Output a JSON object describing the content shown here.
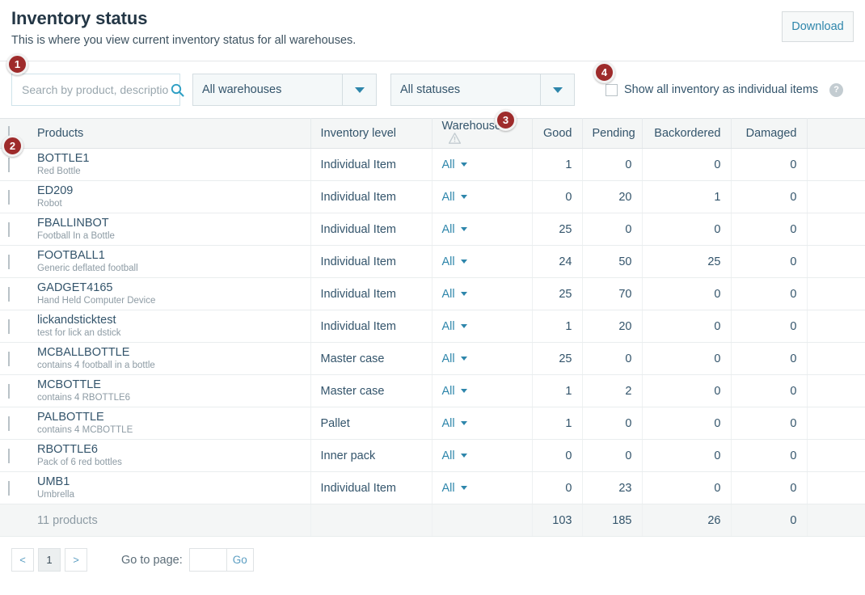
{
  "header": {
    "title": "Inventory status",
    "subtitle": "This is where you view current inventory status for all warehouses.",
    "download_label": "Download"
  },
  "toolbar": {
    "search_placeholder": "Search by product, description",
    "search_value": "",
    "search_icon": "search-icon",
    "warehouse_filter": "All warehouses",
    "status_filter": "All statuses",
    "show_individual_label": "Show all inventory as individual items",
    "show_individual_checked": false,
    "help_icon": "?"
  },
  "table": {
    "columns": {
      "products": "Products",
      "inventory_level": "Inventory level",
      "warehouse": "Warehouse",
      "good": "Good",
      "pending": "Pending",
      "backordered": "Backordered",
      "damaged": "Damaged"
    },
    "warehouse_cell_label": "All",
    "rows": [
      {
        "sku": "BOTTLE1",
        "desc": "Red Bottle",
        "level": "Individual Item",
        "warehouse": "All",
        "good": "1",
        "pending": "0",
        "backordered": "0",
        "damaged": "0"
      },
      {
        "sku": "ED209",
        "desc": "Robot",
        "level": "Individual Item",
        "warehouse": "All",
        "good": "0",
        "pending": "20",
        "backordered": "1",
        "damaged": "0"
      },
      {
        "sku": "FBALLINBOT",
        "desc": "Football In a Bottle",
        "level": "Individual Item",
        "warehouse": "All",
        "good": "25",
        "pending": "0",
        "backordered": "0",
        "damaged": "0"
      },
      {
        "sku": "FOOTBALL1",
        "desc": "Generic deflated football",
        "level": "Individual Item",
        "warehouse": "All",
        "good": "24",
        "pending": "50",
        "backordered": "25",
        "damaged": "0"
      },
      {
        "sku": "GADGET4165",
        "desc": "Hand Held Computer Device",
        "level": "Individual Item",
        "warehouse": "All",
        "good": "25",
        "pending": "70",
        "backordered": "0",
        "damaged": "0"
      },
      {
        "sku": "lickandsticktest",
        "desc": "test for lick an dstick",
        "level": "Individual Item",
        "warehouse": "All",
        "good": "1",
        "pending": "20",
        "backordered": "0",
        "damaged": "0"
      },
      {
        "sku": "MCBALLBOTTLE",
        "desc": "contains 4 football in a bottle",
        "level": "Master case",
        "warehouse": "All",
        "good": "25",
        "pending": "0",
        "backordered": "0",
        "damaged": "0"
      },
      {
        "sku": "MCBOTTLE",
        "desc": "contains 4 RBOTTLE6",
        "level": "Master case",
        "warehouse": "All",
        "good": "1",
        "pending": "2",
        "backordered": "0",
        "damaged": "0"
      },
      {
        "sku": "PALBOTTLE",
        "desc": "contains 4 MCBOTTLE",
        "level": "Pallet",
        "warehouse": "All",
        "good": "1",
        "pending": "0",
        "backordered": "0",
        "damaged": "0"
      },
      {
        "sku": "RBOTTLE6",
        "desc": "Pack of 6 red bottles",
        "level": "Inner pack",
        "warehouse": "All",
        "good": "0",
        "pending": "0",
        "backordered": "0",
        "damaged": "0"
      },
      {
        "sku": "UMB1",
        "desc": "Umbrella",
        "level": "Individual Item",
        "warehouse": "All",
        "good": "0",
        "pending": "23",
        "backordered": "0",
        "damaged": "0"
      }
    ],
    "totals": {
      "label": "11 products",
      "good": "103",
      "pending": "185",
      "backordered": "26",
      "damaged": "0"
    }
  },
  "pagination": {
    "prev": "<",
    "next": ">",
    "current_page": "1",
    "goto_label": "Go to page:",
    "goto_value": "",
    "go_label": "Go"
  },
  "annotations": [
    {
      "number": "1"
    },
    {
      "number": "2"
    },
    {
      "number": "3"
    },
    {
      "number": "4"
    }
  ],
  "colors": {
    "accent": "#2e86ab",
    "badge": "#9e2b2b",
    "text": "#33546b",
    "muted": "#8d9ba4"
  }
}
